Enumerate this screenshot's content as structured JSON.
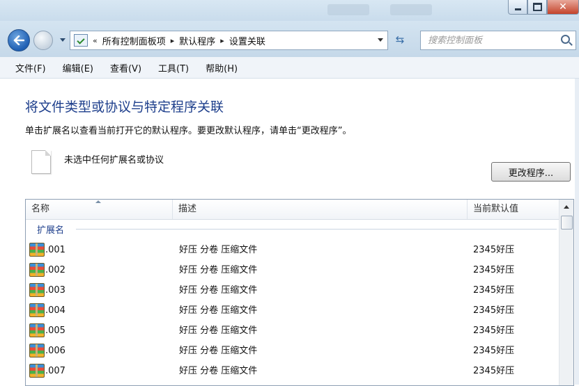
{
  "address_bar": {
    "crumbs": [
      "所有控制面板项",
      "默认程序",
      "设置关联"
    ],
    "search_placeholder": "搜索控制面板"
  },
  "menu": [
    "文件(F)",
    "编辑(E)",
    "查看(V)",
    "工具(T)",
    "帮助(H)"
  ],
  "main": {
    "heading": "将文件类型或协议与特定程序关联",
    "description": "单击扩展名以查看当前打开它的默认程序。要更改默认程序，请单击“更改程序”。",
    "no_selection": "未选中任何扩展名或协议",
    "change_button": "更改程序..."
  },
  "list": {
    "columns": [
      "名称",
      "描述",
      "当前默认值"
    ],
    "group": "扩展名",
    "rows": [
      {
        "name": ".001",
        "description": "好压 分卷 压缩文件",
        "default": "2345好压"
      },
      {
        "name": ".002",
        "description": "好压 分卷 压缩文件",
        "default": "2345好压"
      },
      {
        "name": ".003",
        "description": "好压 分卷 压缩文件",
        "default": "2345好压"
      },
      {
        "name": ".004",
        "description": "好压 分卷 压缩文件",
        "default": "2345好压"
      },
      {
        "name": ".005",
        "description": "好压 分卷 压缩文件",
        "default": "2345好压"
      },
      {
        "name": ".006",
        "description": "好压 分卷 压缩文件",
        "default": "2345好压"
      },
      {
        "name": ".007",
        "description": "好压 分卷 压缩文件",
        "default": "2345好压"
      }
    ]
  },
  "icons": {
    "back": "back-arrow-icon",
    "forward": "forward-arrow-icon",
    "refresh": "refresh-icon",
    "search": "search-icon",
    "file_type": "archive-icon"
  },
  "colors": {
    "heading": "#1e3f8c",
    "chrome": "#c9dcec"
  }
}
